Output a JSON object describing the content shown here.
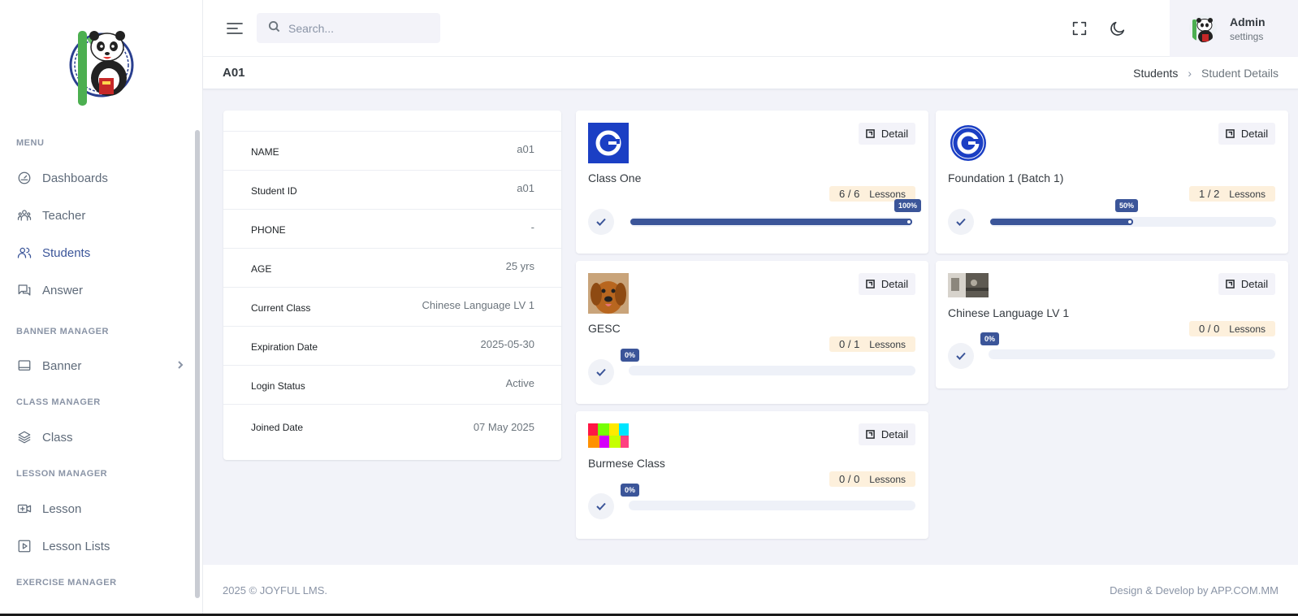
{
  "sidebar": {
    "sections": [
      {
        "title": "MENU",
        "items": [
          {
            "label": "Dashboards",
            "icon": "speedometer-icon"
          },
          {
            "label": "Teacher",
            "icon": "users-group-icon"
          },
          {
            "label": "Students",
            "icon": "users-icon"
          },
          {
            "label": "Answer",
            "icon": "chat-icon"
          }
        ]
      },
      {
        "title": "BANNER MANAGER",
        "items": [
          {
            "label": "Banner",
            "icon": "monitor-icon"
          }
        ]
      },
      {
        "title": "CLASS MANAGER",
        "items": [
          {
            "label": "Class",
            "icon": "layers-icon"
          }
        ]
      },
      {
        "title": "LESSON MANAGER",
        "items": [
          {
            "label": "Lesson",
            "icon": "video-add-icon"
          },
          {
            "label": "Lesson Lists",
            "icon": "play-square-icon"
          }
        ]
      },
      {
        "title": "EXERCISE MANAGER",
        "items": []
      }
    ]
  },
  "header": {
    "search_placeholder": "Search...",
    "user": {
      "name": "Admin",
      "subtitle": "settings"
    }
  },
  "page": {
    "title": "A01",
    "breadcrumb": [
      "Students",
      "Student Details"
    ]
  },
  "student": {
    "fields": [
      {
        "label": "NAME",
        "value": "a01"
      },
      {
        "label": "Student ID",
        "value": "a01"
      },
      {
        "label": "PHONE",
        "value": "-"
      },
      {
        "label": "AGE",
        "value": "25 yrs"
      },
      {
        "label": "Current Class",
        "value": "Chinese Language LV 1"
      },
      {
        "label": "Expiration Date",
        "value": "2025-05-30"
      },
      {
        "label": "Login Status",
        "value": "Active"
      },
      {
        "label": "Joined Date",
        "value": "07 May 2025"
      }
    ]
  },
  "classes": [
    {
      "name": "Class One",
      "lessons": "6 / 6",
      "lessons_label": "Lessons",
      "progress": 100,
      "progress_label": "100%",
      "detail_label": "Detail"
    },
    {
      "name": "Foundation 1 (Batch 1)",
      "lessons": "1 / 2",
      "lessons_label": "Lessons",
      "progress": 50,
      "progress_label": "50%",
      "detail_label": "Detail"
    },
    {
      "name": "GESC",
      "lessons": "0 / 1",
      "lessons_label": "Lessons",
      "progress": 0,
      "progress_label": "0%",
      "detail_label": "Detail"
    },
    {
      "name": "Chinese Language LV 1",
      "lessons": "0 / 0",
      "lessons_label": "Lessons",
      "progress": 0,
      "progress_label": "0%",
      "detail_label": "Detail"
    },
    {
      "name": "Burmese Class",
      "lessons": "0 / 0",
      "lessons_label": "Lessons",
      "progress": 0,
      "progress_label": "0%",
      "detail_label": "Detail"
    }
  ],
  "footer": {
    "left": "2025 © JOYFUL LMS.",
    "right": "Design & Develop by APP.COM.MM"
  },
  "colors": {
    "accent": "#3b5599",
    "badge_bg": "#fdf0dc",
    "page_bg": "#f2f3f9"
  }
}
